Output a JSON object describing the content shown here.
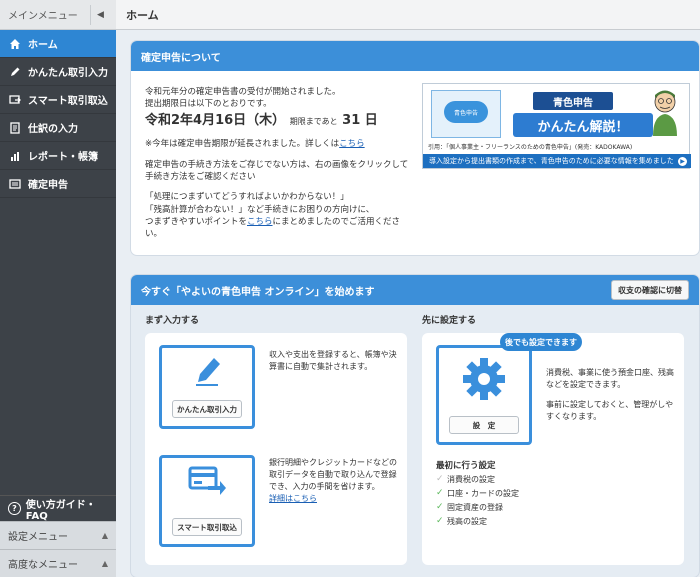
{
  "sidebar": {
    "header": "メインメニュー",
    "items": [
      {
        "label": "ホーム",
        "icon": "home-icon",
        "active": true
      },
      {
        "label": "かんたん取引入力",
        "icon": "pencil-icon"
      },
      {
        "label": "スマート取引取込",
        "icon": "import-icon"
      },
      {
        "label": "仕訳の入力",
        "icon": "journal-icon"
      },
      {
        "label": "レポート・帳簿",
        "icon": "report-icon"
      },
      {
        "label": "確定申告",
        "icon": "tax-return-icon"
      }
    ],
    "faq": "使い方ガイド・FAQ",
    "submenus": [
      "設定メニュー",
      "高度なメニュー"
    ]
  },
  "topbar": {
    "title": "ホーム"
  },
  "tax": {
    "title": "確定申告について",
    "line1": "令和元年分の確定申告書の受付が開始されました。",
    "line2": "提出期限日は以下のとおりです。",
    "deadline": "令和2年4月16日（木）",
    "deadline_small": "期限まであと",
    "days": "31 日",
    "note": "※今年は確定申告期限が延長されました。詳しくは",
    "note_link": "こちら",
    "howto": "確定申告の手続き方法をご存じでない方は、右の画像をクリックして手続き方法をご確認ください",
    "quote1": "「処理につまずいてどうすればよいかわからない！」",
    "quote2": "「残高計算が合わない！」など手続きにお困りの方向けに、",
    "quote3a": "つまずきやすいポイントを",
    "quote3_link": "こちら",
    "quote3b": "にまとめましたのでご活用ください。",
    "banner": {
      "book_label": "青色申告",
      "title": "青色申告",
      "subtitle": "かんたん解説！",
      "cite": "引用：「個人事業主・フリーランスのための青色申告」(発売：KADOKAWA)",
      "footer": "導入設定から提出書類の作成まで、青色申告のために必要な情報を集めました"
    }
  },
  "start": {
    "title": "今すぐ「やよいの青色申告 オンライン」を始めます",
    "switch_button": "収支の確認に切替",
    "left_label": "まず入力する",
    "right_label": "先に設定する",
    "easy_button": "かんたん取引入力",
    "easy_desc": "収入や支出を登録すると、帳簿や決算書に自動で集計されます。",
    "smart_button": "スマート取引取込",
    "smart_desc": "銀行明細やクレジットカードなどの取引データを自動で取り込んで登録でき、入力の手間を省けます。",
    "smart_link": "詳細はこちら",
    "bubble": "後でも設定できます",
    "settings_button": "設　定",
    "settings_desc1": "消費税、事業に使う預金口座、残高などを設定できます。",
    "settings_desc2": "事前に設定しておくと、管理がしやすくなります。",
    "setup_title": "最初に行う設定",
    "setup_items": [
      {
        "label": "消費税の設定",
        "done": false
      },
      {
        "label": "口座・カードの設定",
        "done": true
      },
      {
        "label": "固定資産の登録",
        "done": true
      },
      {
        "label": "残高の設定",
        "done": true
      }
    ]
  },
  "colors": {
    "accent": "#3c8fd9",
    "sidebar": "#3d4248",
    "active": "#2e86d3"
  }
}
